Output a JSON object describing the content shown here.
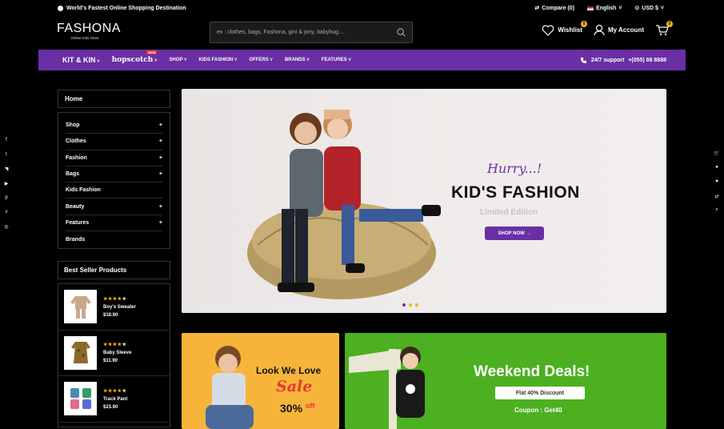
{
  "topbar": {
    "tagline": "World's Fastest Online Shopping Destination",
    "compare": "Compare (0)",
    "language": "English",
    "currency": "USD $"
  },
  "header": {
    "logo_main": "FASHONA",
    "logo_sub": "Online Kids Store",
    "search_placeholder": "ex : clothes, bags, Fashona, gini & jony, babyhug....",
    "wishlist_label": "Wishlist",
    "wishlist_count": "0",
    "account_label": "My Account",
    "cart_count": "0"
  },
  "nav": {
    "brand1": "KIT & KIN",
    "brand2": "hopscotch",
    "new_tag": "NEW",
    "items": [
      "SHOP",
      "KIDS FASHION",
      "OFFERS",
      "BRANDS",
      "FEATURES"
    ],
    "support_label": "24/7 support",
    "support_phone": "+(055) 88 8888"
  },
  "sidebar": {
    "home": "Home",
    "categories": [
      {
        "label": "Shop",
        "expand": "+"
      },
      {
        "label": "Clothes",
        "expand": "+"
      },
      {
        "label": "Fashion",
        "expand": "+"
      },
      {
        "label": "Bags",
        "expand": "+"
      },
      {
        "label": "Kids Fashion",
        "expand": ""
      },
      {
        "label": "Beauty",
        "expand": "+"
      },
      {
        "label": "Features",
        "expand": "+"
      },
      {
        "label": "Brands",
        "expand": ""
      }
    ],
    "best_seller_title": "Best Seller Products",
    "products": [
      {
        "name": "Boy's Sweater",
        "price": "$18.90",
        "rating": 4
      },
      {
        "name": "Baby Sleeve",
        "price": "$11.90",
        "rating": 4
      },
      {
        "name": "Track Pant",
        "price": "$23.90",
        "rating": 4
      }
    ]
  },
  "hero": {
    "kicker": "Hurry...!",
    "title": "KID'S FASHION",
    "subtitle": "Limited Edition",
    "button": "SHOP NOW →"
  },
  "banner_sale": {
    "line1": "Look We Love",
    "line2": "Sale",
    "pct": "30%",
    "off": "off"
  },
  "banner_deals": {
    "title": "Weekend Deals!",
    "discount": "Flat 40% Discount",
    "coupon": "Coupon : Get40"
  },
  "colors": {
    "purple": "#6a2fa4",
    "yellow": "#f2b712",
    "green": "#4cb020",
    "orange": "#f6b53a"
  }
}
